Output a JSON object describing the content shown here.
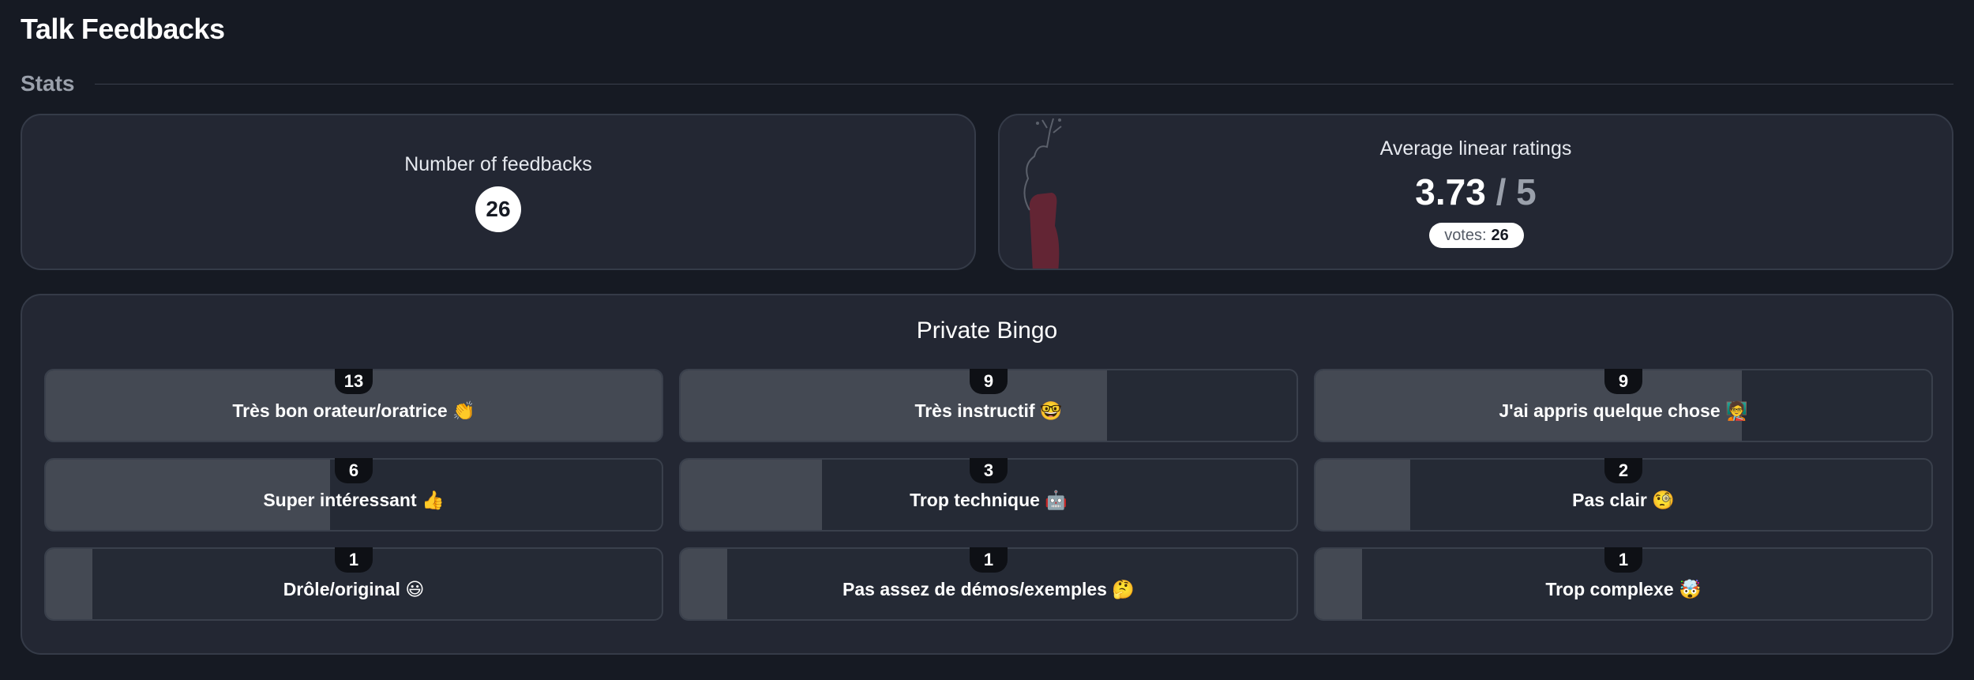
{
  "page": {
    "title": "Talk Feedbacks"
  },
  "stats": {
    "section_label": "Stats",
    "feedbacks": {
      "label": "Number of feedbacks",
      "count": "26"
    },
    "ratings": {
      "label": "Average linear ratings",
      "average": "3.73",
      "max": "/ 5",
      "votes_label": "votes:",
      "votes_count": "26"
    }
  },
  "bingo": {
    "title": "Private Bingo",
    "total_feedbacks": 26,
    "items": [
      {
        "label": "Très bon orateur/oratrice 👏",
        "count": "13",
        "share": 0.5
      },
      {
        "label": "Très instructif 🤓",
        "count": "9",
        "share": 0.346
      },
      {
        "label": "J'ai appris quelque chose 🧑‍🏫",
        "count": "9",
        "share": 0.346
      },
      {
        "label": "Super intéressant 👍",
        "count": "6",
        "share": 0.231
      },
      {
        "label": "Trop technique 🤖",
        "count": "3",
        "share": 0.115
      },
      {
        "label": "Pas clair 🧐",
        "count": "2",
        "share": 0.077
      },
      {
        "label": "Drôle/original 😃",
        "count": "1",
        "share": 0.038
      },
      {
        "label": "Pas assez de démos/exemples 🤔",
        "count": "1",
        "share": 0.038
      },
      {
        "label": "Trop complexe 🤯",
        "count": "1",
        "share": 0.038
      }
    ]
  },
  "colors": {
    "background": "#161a23",
    "card": "#232733",
    "tile_fill": "#444953",
    "badge": "#0e1015",
    "deco_accent": "#7a2535"
  }
}
